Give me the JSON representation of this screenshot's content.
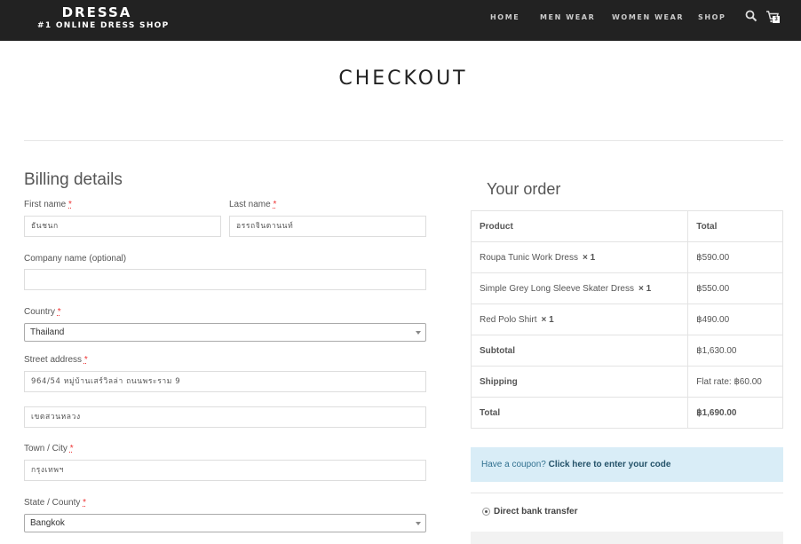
{
  "header": {
    "brand_name": "DRESSA",
    "brand_tagline": "#1 ONLINE DRESS SHOP",
    "nav": [
      "HOME",
      "MEN WEAR",
      "WOMEN WEAR",
      "SHOP"
    ],
    "cart_count": "3",
    "bg_color": "#222222"
  },
  "page": {
    "title": "CHECKOUT"
  },
  "billing": {
    "title": "Billing details",
    "first_name_label": "First name",
    "first_name_value": "ธันชนก",
    "last_name_label": "Last name",
    "last_name_value": "อรรถจินดานนท์",
    "company_label": "Company name (optional)",
    "company_value": "",
    "country_label": "Country",
    "country_value": "Thailand",
    "street_label": "Street address",
    "street_value_1": "964/54 หมู่บ้านเสร์วิลล่า ถนนพระราม 9",
    "street_value_2": "เขตสวนหลวง",
    "city_label": "Town / City",
    "city_value": "กรุงเทพฯ",
    "state_label": "State / County",
    "state_value": "Bangkok",
    "required_mark": "*"
  },
  "order": {
    "title": "Your order",
    "col_product": "Product",
    "col_total": "Total",
    "items": [
      {
        "name": "Roupa Tunic Work Dress",
        "qty": "× 1",
        "total": "฿590.00"
      },
      {
        "name": "Simple Grey Long Sleeve Skater Dress",
        "qty": "× 1",
        "total": "฿550.00"
      },
      {
        "name": "Red Polo Shirt",
        "qty": "× 1",
        "total": "฿490.00"
      }
    ],
    "subtotal_label": "Subtotal",
    "subtotal_value": "฿1,630.00",
    "shipping_label": "Shipping",
    "shipping_value": "Flat rate: ฿60.00",
    "total_label": "Total",
    "total_value": "฿1,690.00"
  },
  "coupon": {
    "text": "Have a coupon?",
    "link": "Click here to enter your code"
  },
  "payment": {
    "method": "Direct bank transfer"
  }
}
